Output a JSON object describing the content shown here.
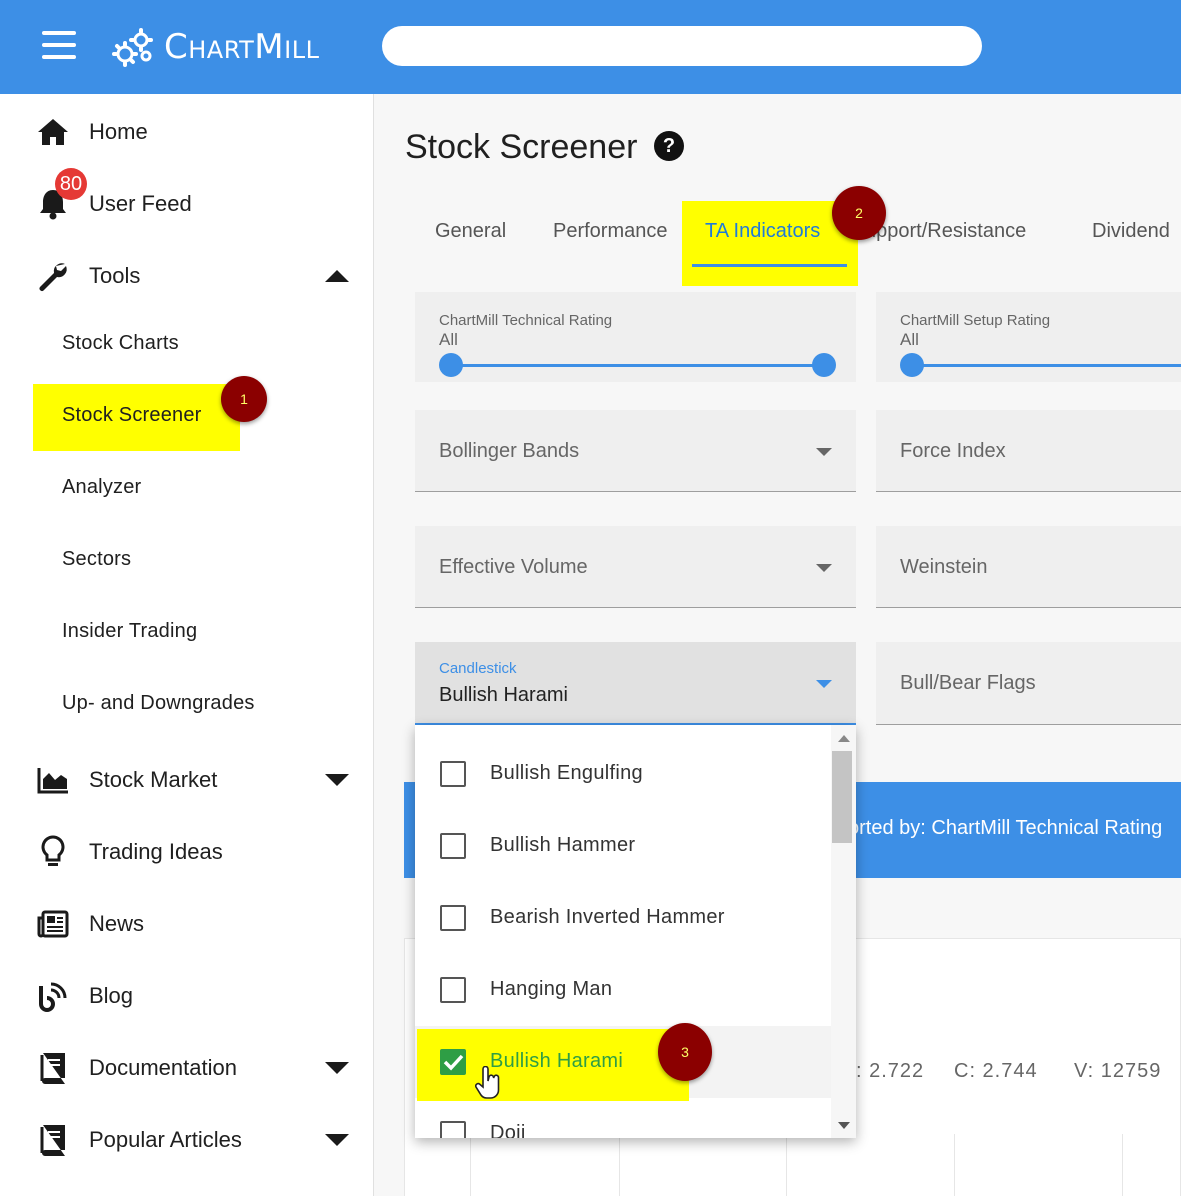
{
  "header": {
    "logo_text": "ChartMill",
    "search_placeholder": "",
    "brand_color": "#3d8fe6"
  },
  "sidebar": {
    "items": [
      {
        "label": "Home",
        "icon": "home-icon"
      },
      {
        "label": "User Feed",
        "icon": "bell-icon",
        "badge": "80"
      },
      {
        "label": "Tools",
        "icon": "wrench-icon",
        "expanded": true
      },
      {
        "label": "Stock Market",
        "icon": "area-chart-icon"
      },
      {
        "label": "Trading Ideas",
        "icon": "lightbulb-icon"
      },
      {
        "label": "News",
        "icon": "newspaper-icon"
      },
      {
        "label": "Blog",
        "icon": "blog-icon"
      },
      {
        "label": "Documentation",
        "icon": "book-icon"
      },
      {
        "label": "Popular Articles",
        "icon": "book-icon"
      }
    ],
    "tools_subitems": [
      "Stock Charts",
      "Stock Screener",
      "Analyzer",
      "Sectors",
      "Insider Trading",
      "Up- and Downgrades"
    ]
  },
  "annotations": {
    "step1": "1",
    "step2": "2",
    "step3": "3"
  },
  "main": {
    "page_title": "Stock Screener",
    "help_glyph": "?",
    "tabs": [
      "General",
      "Performance",
      "TA Indicators",
      "upport/Resistance",
      "Dividend"
    ],
    "active_tab": "TA Indicators",
    "technical_rating": {
      "label": "ChartMill Technical Rating",
      "value": "All"
    },
    "setup_rating": {
      "label": "ChartMill Setup Rating",
      "value": "All"
    },
    "filters": {
      "bollinger": "Bollinger Bands",
      "force_index": "Force Index",
      "effective_volume": "Effective Volume",
      "weinstein": "Weinstein",
      "candlestick_label": "Candlestick",
      "candlestick_value": "Bullish Harami",
      "bull_bear_flags": "Bull/Bear Flags"
    },
    "sorted_by": "orted by: ChartMill Technical Rating",
    "ohlc": {
      "l": ": 2.722",
      "c": "C: 2.744",
      "v": "V: 12759"
    }
  },
  "dropdown": {
    "options": [
      {
        "label": "Bullish Engulfing",
        "checked": false
      },
      {
        "label": "Bullish Hammer",
        "checked": false
      },
      {
        "label": "Bearish Inverted Hammer",
        "checked": false
      },
      {
        "label": "Hanging Man",
        "checked": false
      },
      {
        "label": "Bullish Harami",
        "checked": true
      },
      {
        "label": "Doji",
        "checked": false
      }
    ]
  }
}
